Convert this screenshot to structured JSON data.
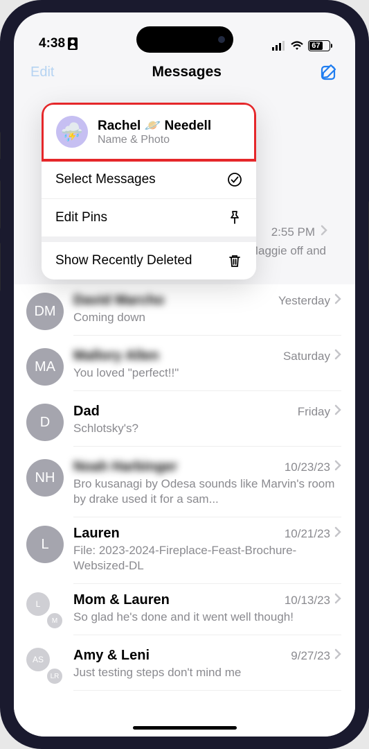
{
  "status": {
    "time": "4:38",
    "battery_pct": "67"
  },
  "nav": {
    "edit": "Edit",
    "title": "Messages"
  },
  "popover": {
    "name_prefix": "Rachel",
    "name_suffix": "Needell",
    "subtitle": "Name & Photo",
    "select": "Select Messages",
    "edit_pins": "Edit Pins",
    "show_deleted": "Show Recently Deleted"
  },
  "peek": {
    "time": "2:55 PM",
    "preview": "d Maggie off and"
  },
  "conversations": [
    {
      "initials": "DM",
      "name": "David Marcho",
      "time": "Yesterday",
      "preview": "Coming down",
      "blur": true
    },
    {
      "initials": "MA",
      "name": "Mallory Allen",
      "time": "Saturday",
      "preview": "You loved \"perfect!!\"",
      "blur": true
    },
    {
      "initials": "D",
      "name": "Dad",
      "time": "Friday",
      "preview": "Schlotsky's?",
      "blur": false
    },
    {
      "initials": "NH",
      "name": "Noah Harbinger",
      "time": "10/23/23",
      "preview": "Bro kusanagi by Odesa sounds like Marvin's room by drake used it for a sam...",
      "blur": true
    },
    {
      "initials": "L",
      "name": "Lauren",
      "time": "10/21/23",
      "preview": "File: 2023-2024-Fireplace-Feast-Brochure-Websized-DL",
      "blur": false
    },
    {
      "group": [
        "L",
        "M"
      ],
      "name": "Mom & Lauren",
      "time": "10/13/23",
      "preview": "So glad he's done and it went well though!",
      "blur": false
    },
    {
      "group": [
        "AS",
        "LR"
      ],
      "name": "Amy & Leni",
      "time": "9/27/23",
      "preview": "Just testing steps don't mind me",
      "blur": false
    }
  ]
}
